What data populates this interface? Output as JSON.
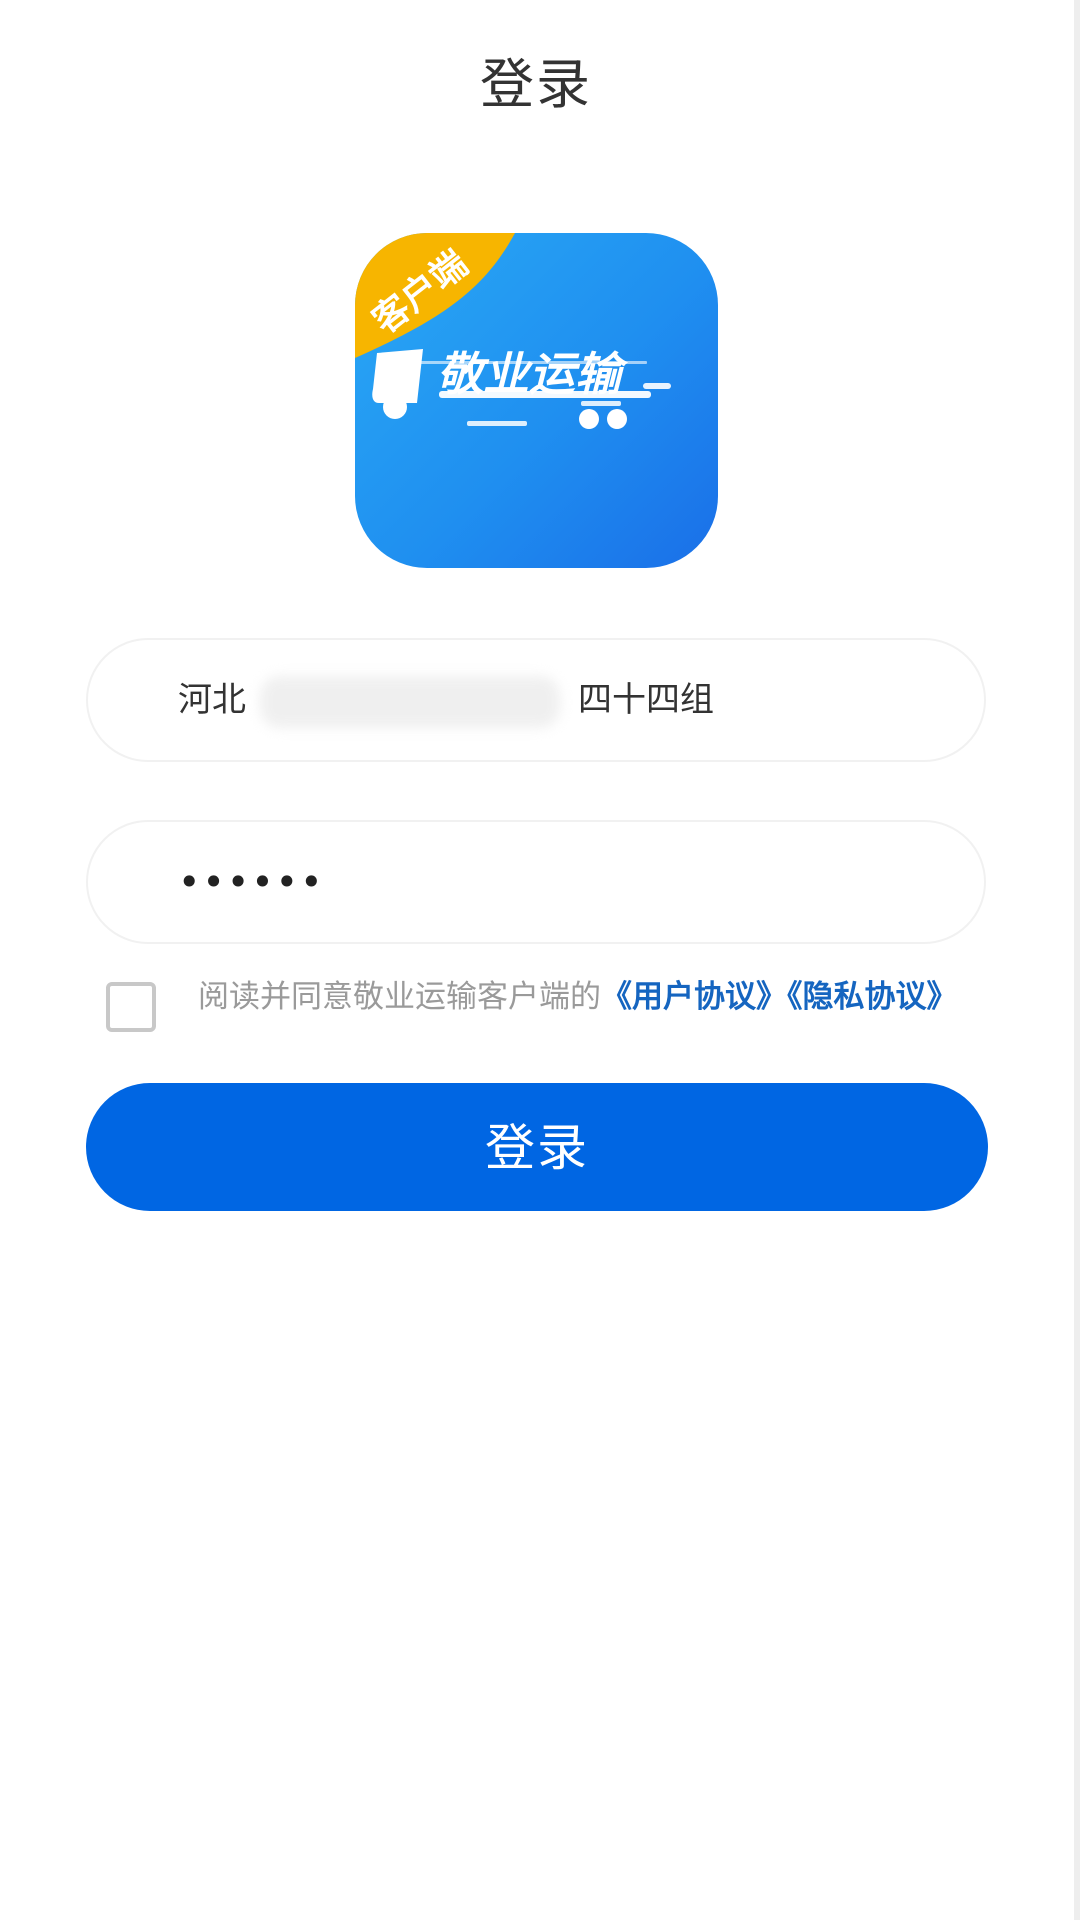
{
  "header": {
    "title": "登录"
  },
  "logo": {
    "badge": "客户端",
    "brand": "敬业运输",
    "colors": {
      "blue_light": "#2aa9f5",
      "blue_dark": "#1a6fe8",
      "badge_yellow": "#f7b500"
    }
  },
  "form": {
    "username_prefix": "河北",
    "username_suffix": "四十四组",
    "password_masked": "••••••",
    "agreement": {
      "text": "阅读并同意敬业运输客户端的",
      "link_user": "《用户协议》",
      "link_privacy": "《隐私协议》"
    },
    "login_label": "登录"
  },
  "colors": {
    "primary": "#0066e3",
    "link": "#1565c0",
    "text": "#333333",
    "muted": "#9a9a9a"
  }
}
